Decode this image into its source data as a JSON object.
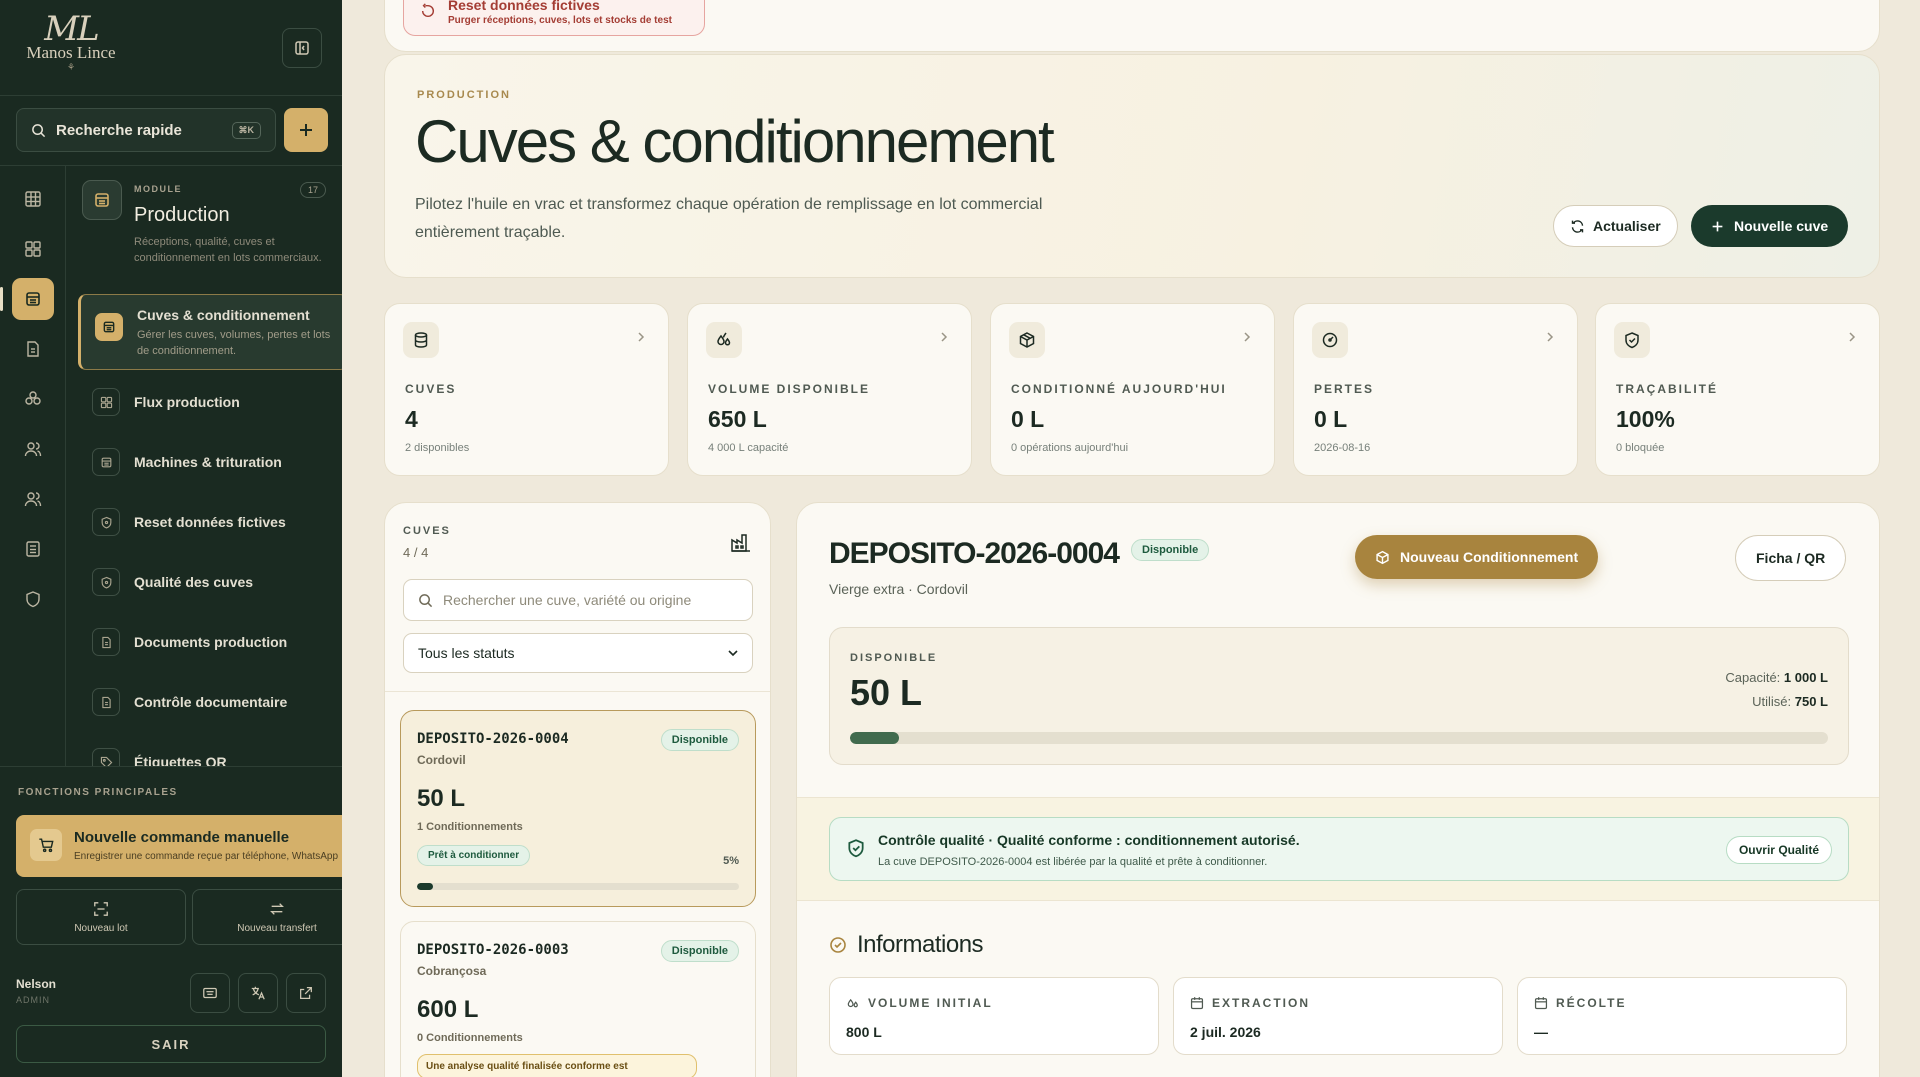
{
  "brand": {
    "script": "ML",
    "name": "Manos Lince",
    "mark": "⚘"
  },
  "search": {
    "label": "Recherche rapide",
    "shortcut": "⌘K"
  },
  "module": {
    "tag": "MODULE",
    "count": "17",
    "title": "Production",
    "desc": "Réceptions, qualité, cuves et conditionnement en lots commerciaux."
  },
  "nav": [
    {
      "label": "Cuves & conditionnement",
      "sub": "Gérer les cuves, volumes, pertes et lots de conditionnement.",
      "icon": "tank-icon"
    },
    {
      "label": "Flux production",
      "icon": "grid-icon"
    },
    {
      "label": "Machines & trituration",
      "icon": "machine-icon"
    },
    {
      "label": "Reset données fictives",
      "icon": "shield-icon"
    },
    {
      "label": "Qualité des cuves",
      "icon": "shield-icon"
    },
    {
      "label": "Documents production",
      "icon": "document-icon"
    },
    {
      "label": "Contrôle documentaire",
      "icon": "document-icon"
    },
    {
      "label": "Étiquettes QR",
      "icon": "tag-icon"
    }
  ],
  "functions": {
    "label": "FONCTIONS PRINCIPALES",
    "main_title": "Nouvelle commande manuelle",
    "main_sub": "Enregistrer une commande reçue par téléphone, WhatsApp",
    "new_lot": "Nouveau lot",
    "new_transfer": "Nouveau transfert"
  },
  "user": {
    "name": "Nelson",
    "role": "ADMIN",
    "logout": "SAIR"
  },
  "reset": {
    "title": "Reset données fictives",
    "sub": "Purger réceptions, cuves, lots et stocks de test"
  },
  "hero": {
    "eyebrow": "PRODUCTION",
    "title": "Cuves & conditionnement",
    "desc": "Pilotez l'huile en vrac et transformez chaque opération de remplissage en lot commercial entièrement traçable.",
    "refresh": "Actualiser",
    "new_tank": "Nouvelle cuve"
  },
  "stats": [
    {
      "label": "CUVES",
      "value": "4",
      "sub": "2 disponibles",
      "icon": "database-icon"
    },
    {
      "label": "VOLUME DISPONIBLE",
      "value": "650 L",
      "sub": "4 000 L capacité",
      "icon": "droplets-icon"
    },
    {
      "label": "CONDITIONNÉ AUJOURD'HUI",
      "value": "0 L",
      "sub": "0 opérations aujourd'hui",
      "icon": "package-icon"
    },
    {
      "label": "PERTES",
      "value": "0 L",
      "sub": "2026-08-16",
      "icon": "gauge-icon"
    },
    {
      "label": "TRAÇABILITÉ",
      "value": "100%",
      "sub": "0 bloquée",
      "icon": "shield-check-icon"
    }
  ],
  "list": {
    "title": "CUVES",
    "count": "4 / 4",
    "search_placeholder": "Rechercher une cuve, variété ou origine",
    "filter": "Tous les statuts",
    "tanks": [
      {
        "name": "DEPOSITO-2026-0004",
        "status": "Disponible",
        "origin": "Cordovil",
        "volume": "50 L",
        "ops": "1 Conditionnements",
        "ready": "Prêt à conditionner",
        "pct_label": "5%",
        "fill": 0.05
      },
      {
        "name": "DEPOSITO-2026-0003",
        "status": "Disponible",
        "origin": "Cobrançosa",
        "volume": "600 L",
        "ops": "0 Conditionnements",
        "warning": "Une analyse qualité finalisée conforme est"
      }
    ]
  },
  "detail": {
    "title": "DEPOSITO-2026-0004",
    "status": "Disponible",
    "subtitle": "Vierge extra · Cordovil",
    "new_pack": "Nouveau Conditionnement",
    "sheet": "Ficha / QR",
    "available_label": "DISPONIBLE",
    "available_value": "50 L",
    "capacity_label": "Capacité:",
    "capacity_value": "1 000 L",
    "used_label": "Utilisé:",
    "used_value": "750 L",
    "fill": 0.05,
    "qc_title": "Contrôle qualité · Qualité conforme : conditionnement autorisé.",
    "qc_desc": "La cuve DEPOSITO-2026-0004 est libérée par la qualité et prête à conditionner.",
    "qc_button": "Ouvrir Qualité",
    "info_title": "Informations",
    "info": [
      {
        "label": "VOLUME INITIAL",
        "value": "800 L",
        "icon": "droplets-icon"
      },
      {
        "label": "EXTRACTION",
        "value": "2 juil. 2026",
        "icon": "calendar-icon"
      },
      {
        "label": "RÉCOLTE",
        "value": "—",
        "icon": "calendar-icon"
      }
    ]
  }
}
